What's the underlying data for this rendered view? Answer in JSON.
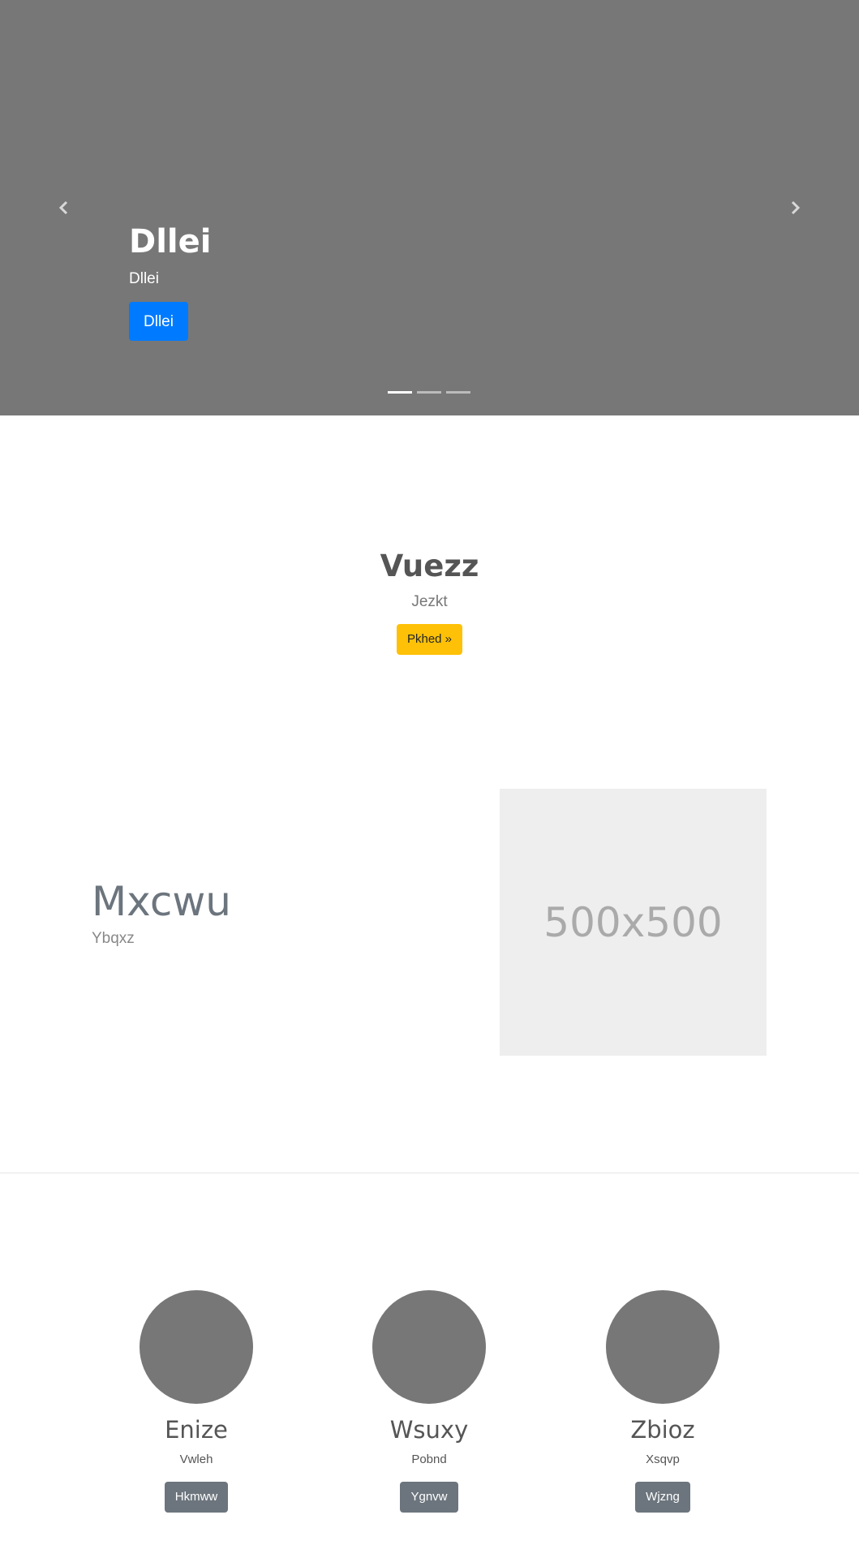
{
  "carousel": {
    "prev_icon": "chevron-left-icon",
    "next_icon": "chevron-right-icon",
    "slide": {
      "title": "Dllei",
      "text": "Dllei",
      "button": "Dllei"
    },
    "indicator_count": 3,
    "active_indicator": 1
  },
  "intro": {
    "title": "Vuezz",
    "text": "Jezkt",
    "button": "Pkhed »"
  },
  "feature": {
    "title": "Mxcwu",
    "text": "Ybqxz",
    "placeholder": "500x500"
  },
  "columns": [
    {
      "title": "Enize",
      "text": "Vwleh",
      "button": "Hkmww"
    },
    {
      "title": "Wsuxy",
      "text": "Pobnd",
      "button": "Ygnvw"
    },
    {
      "title": "Zbioz",
      "text": "Xsqvp",
      "button": "Wjzng"
    }
  ],
  "colors": {
    "carousel_bg": "#777777",
    "primary": "#007bff",
    "warning": "#ffc107",
    "secondary": "#6c757d"
  }
}
